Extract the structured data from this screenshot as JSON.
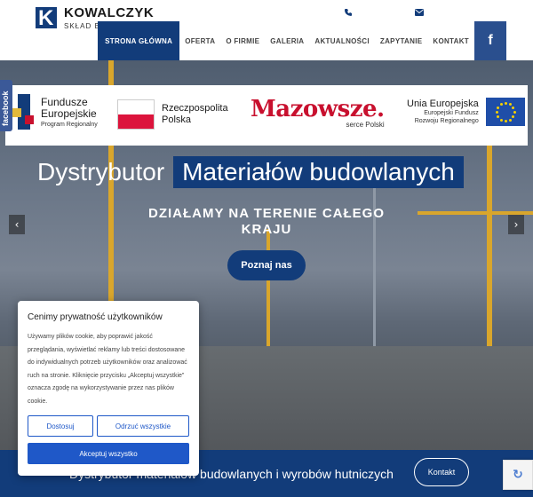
{
  "brand": {
    "name": "KOWALCZYK",
    "subtitle": "SKŁAD BUDOWLANY"
  },
  "header": {
    "nav": [
      "STRONA GŁÓWNA",
      "OFERTA",
      "O FIRMIE",
      "GALERIA",
      "AKTUALNOŚCI",
      "ZAPYTANIE",
      "KONTAKT"
    ],
    "active_index": 0,
    "fb_label": "f"
  },
  "eu_bar": {
    "fundusze_title": "Fundusze Europejskie",
    "fundusze_sub": "Program Regionalny",
    "rp_title": "Rzeczpospolita Polska",
    "mazowsze": "Mazowsze.",
    "mazowsze_sub": "serce Polski",
    "ue_title": "Unia Europejska",
    "ue_sub1": "Europejski Fundusz",
    "ue_sub2": "Rozwoju Regionalnego"
  },
  "facebook_tab": "facebook",
  "slide": {
    "title_a": "Dystrybutor",
    "title_b": "Materiałów budowlanych",
    "subtitle": "DZIAŁAMY NA TERENIE CAŁEGO KRAJU",
    "cta": "Poznaj nas",
    "prev": "‹",
    "next": "›"
  },
  "banner": {
    "text": "Dystrybutor materiałów budowlanych i wyrobów hutniczych",
    "button": "Kontakt"
  },
  "cookie": {
    "title": "Cenimy prywatność użytkowników",
    "body": "Używamy plików cookie, aby poprawić jakość przeglądania, wyświetlać reklamy lub treści dostosowane do indywidualnych potrzeb użytkowników oraz analizować ruch na stronie. Kliknięcie przycisku „Akceptuj wszystkie” oznacza zgodę na wykorzystywanie przez nas plików cookie.",
    "customize": "Dostosuj",
    "reject": "Odrzuć wszystkie",
    "accept": "Akceptuj wszystko"
  },
  "colors": {
    "primary": "#123c7a",
    "cookie_blue": "#1f58c8",
    "crane": "#d9a62c"
  }
}
